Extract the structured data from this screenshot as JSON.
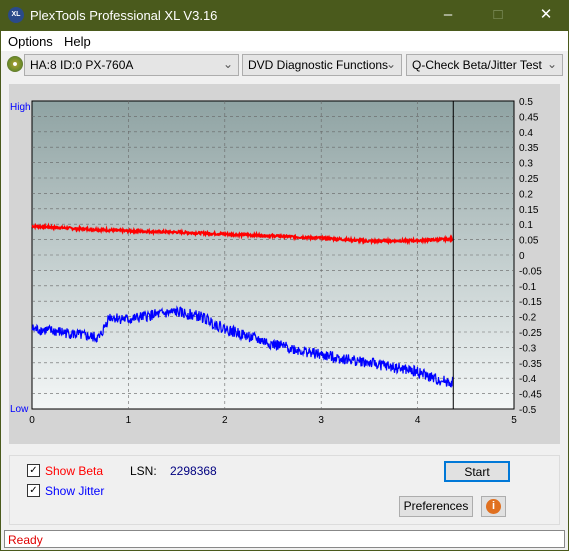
{
  "title": "PlexTools Professional XL V3.16",
  "menu": [
    "Options",
    "Help"
  ],
  "toolbar": {
    "drive": "HA:8 ID:0  PX-760A",
    "function": "DVD Diagnostic Functions",
    "test": "Q-Check Beta/Jitter Test"
  },
  "chart_data": {
    "type": "line",
    "left_labels": {
      "top": "High",
      "bottom": "Low"
    },
    "x_ticks": [
      "0",
      "1",
      "2",
      "3",
      "4",
      "5"
    ],
    "y_ticks": [
      "0.5",
      "0.45",
      "0.4",
      "0.35",
      "0.3",
      "0.25",
      "0.2",
      "0.15",
      "0.1",
      "0.05",
      "0",
      "-0.05",
      "-0.1",
      "-0.15",
      "-0.2",
      "-0.25",
      "-0.3",
      "-0.35",
      "-0.4",
      "-0.45",
      "-0.5"
    ],
    "xlim": [
      0,
      5
    ],
    "ylim": [
      -0.5,
      0.5
    ],
    "grid": true,
    "marker_x": 4.37,
    "series": [
      {
        "color": "#ff0000",
        "x": [
          0,
          0.5,
          1,
          1.5,
          2,
          2.5,
          3,
          3.5,
          4,
          4.37
        ],
        "values": [
          0.094,
          0.085,
          0.078,
          0.074,
          0.068,
          0.062,
          0.055,
          0.045,
          0.047,
          0.052
        ]
      },
      {
        "color": "#0000ff",
        "x": [
          0,
          0.3,
          0.5,
          0.7,
          0.8,
          1,
          1.25,
          1.5,
          1.75,
          2,
          2.5,
          3,
          3.5,
          4,
          4.2,
          4.37
        ],
        "values": [
          -0.24,
          -0.25,
          -0.26,
          -0.27,
          -0.2,
          -0.21,
          -0.195,
          -0.185,
          -0.2,
          -0.24,
          -0.29,
          -0.325,
          -0.35,
          -0.38,
          -0.405,
          -0.415
        ]
      }
    ]
  },
  "controls": {
    "show_beta": "Show Beta",
    "show_jitter": "Show Jitter",
    "lsn_label": "LSN:",
    "lsn_value": "2298368",
    "start": "Start",
    "preferences": "Preferences"
  },
  "status": "Ready"
}
